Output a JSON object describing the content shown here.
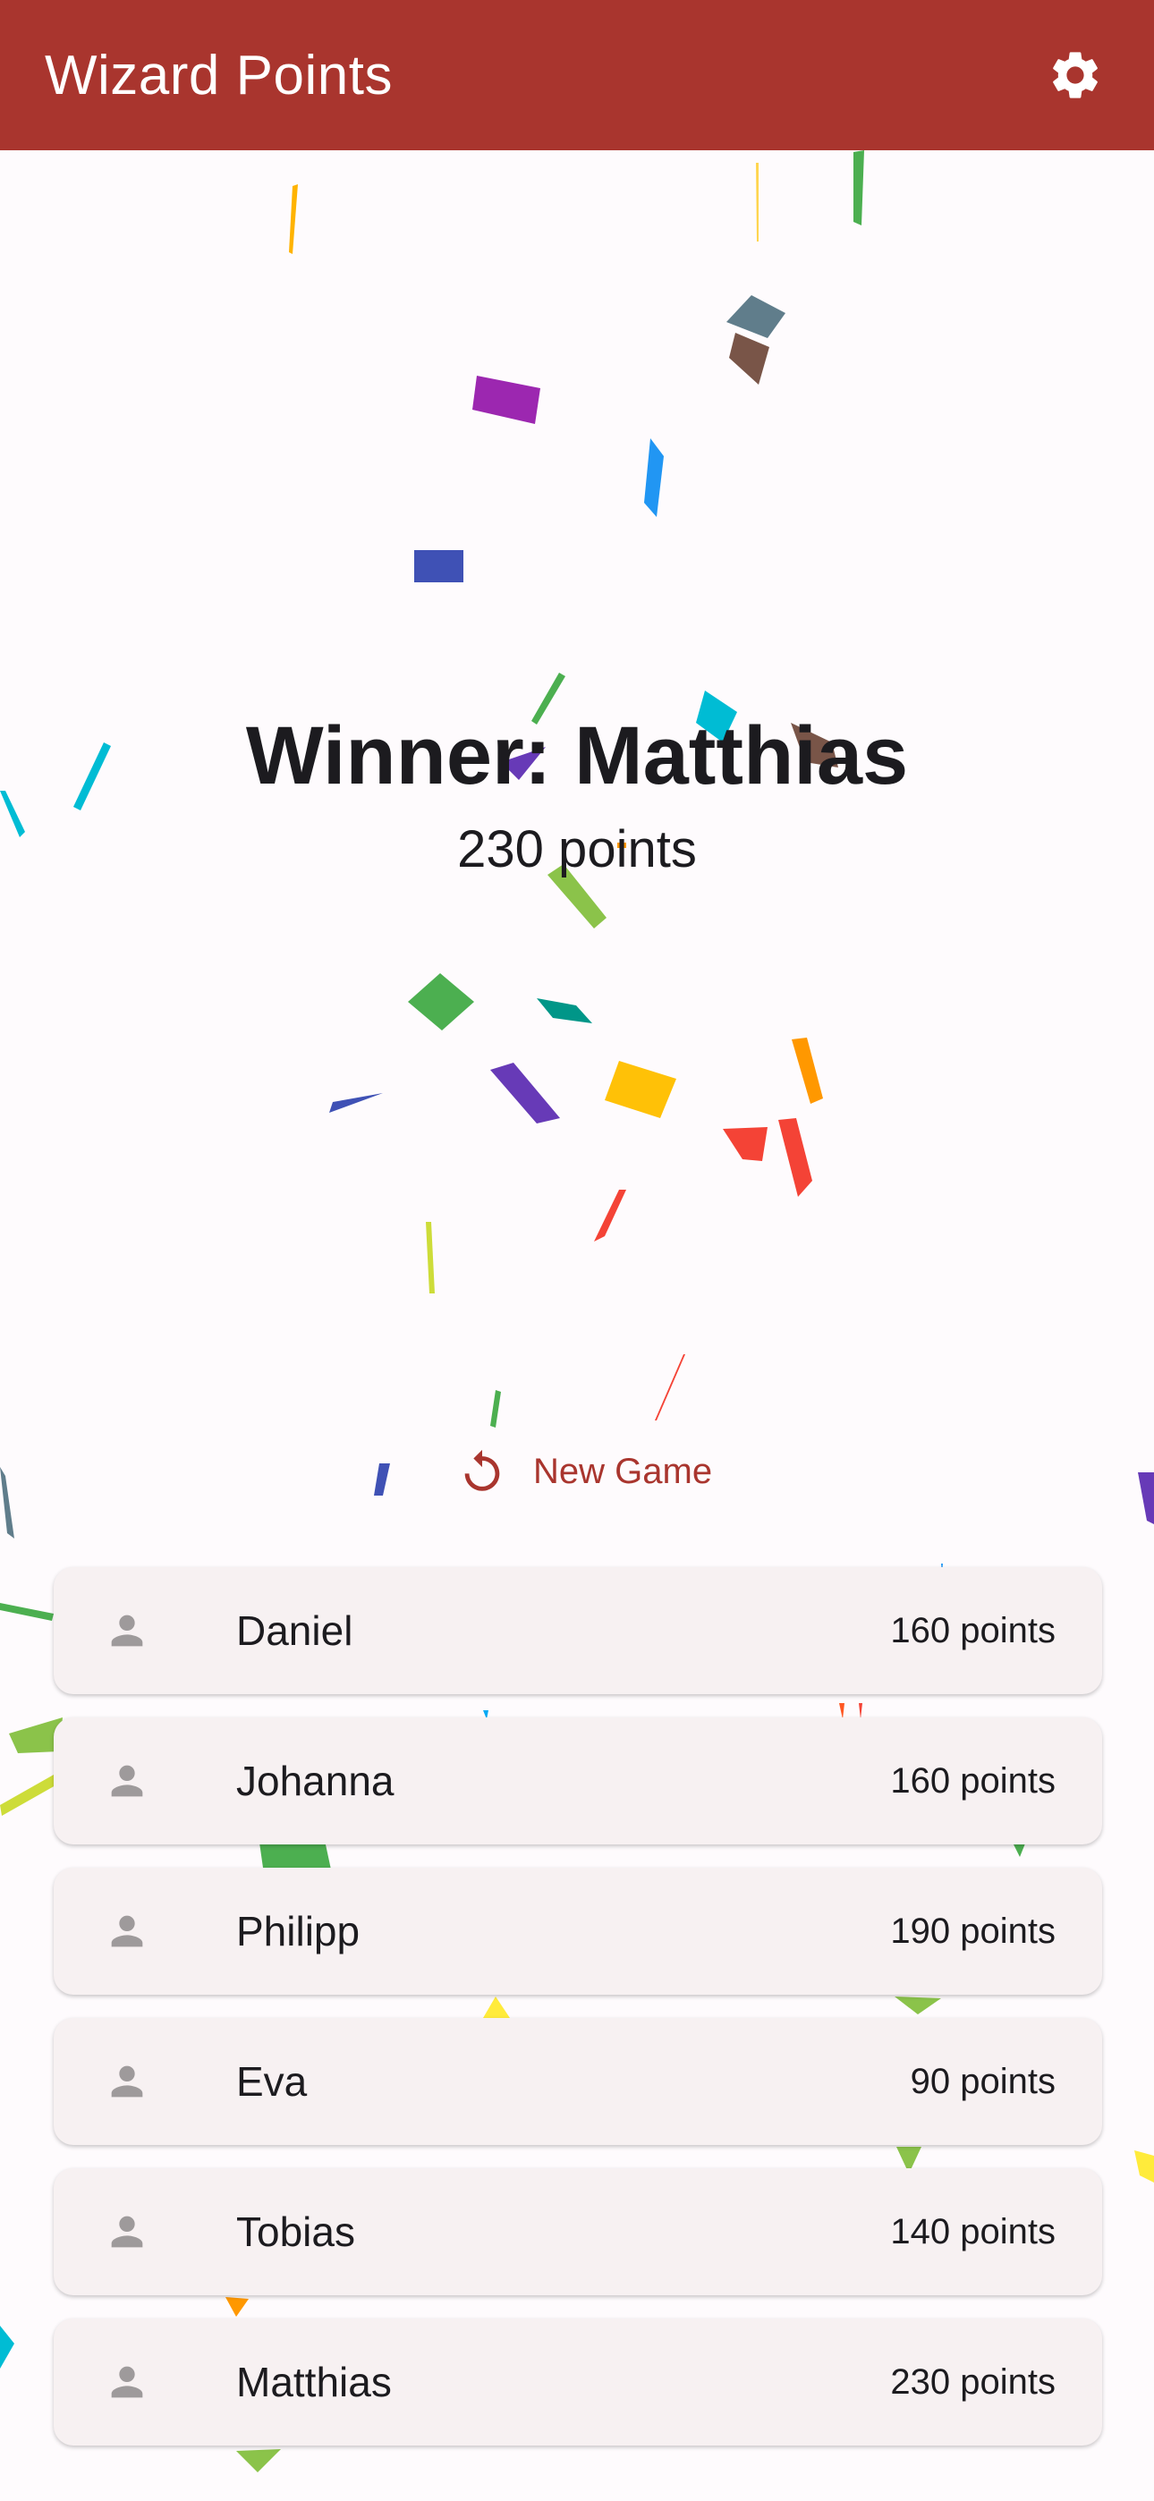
{
  "app_bar": {
    "title": "Wizard Points",
    "settings_icon": "gear-icon"
  },
  "winner": {
    "title": "Winner: Matthias",
    "points": "230 points"
  },
  "new_game": {
    "label": "New Game",
    "icon": "restart-icon"
  },
  "players": [
    {
      "name": "Daniel",
      "points": "160 points",
      "icon": "person-icon"
    },
    {
      "name": "Johanna",
      "points": "160 points",
      "icon": "person-icon"
    },
    {
      "name": "Philipp",
      "points": "190 points",
      "icon": "person-icon"
    },
    {
      "name": "Eva",
      "points": "90 points",
      "icon": "person-icon"
    },
    {
      "name": "Tobias",
      "points": "140 points",
      "icon": "person-icon"
    },
    {
      "name": "Matthias",
      "points": "230 points",
      "icon": "person-icon"
    }
  ],
  "colors": {
    "primary": "#a9352e",
    "background": "#fefbfd",
    "card": "#f7f1f2",
    "icon_gray": "#9e9a9b"
  }
}
